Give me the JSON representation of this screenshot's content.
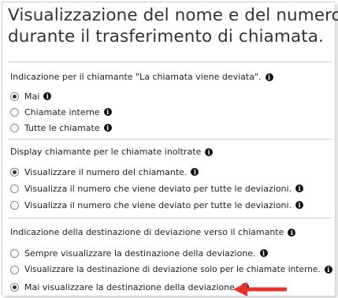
{
  "title_lines": [
    "Visualizzazione del nome e del numero",
    "durante il trasferimento di chiamata."
  ],
  "sections": [
    {
      "label": "Indicazione per il chiamante \"La chiamata viene deviata\".",
      "options": [
        {
          "label": "Mai",
          "checked": true
        },
        {
          "label": "Chiamate interne",
          "checked": false
        },
        {
          "label": "Tutte le chiamate",
          "checked": false
        }
      ]
    },
    {
      "label": "Display chiamante per le chiamate inoltrate",
      "options": [
        {
          "label": "Visualizzare il numero del chiamante.",
          "checked": true
        },
        {
          "label": "Visualizza il numero che viene deviato per tutte le deviazioni.",
          "checked": false
        },
        {
          "label": "Visualizza il numero che viene deviato per tutte le deviazioni.",
          "checked": false
        }
      ]
    },
    {
      "label": "Indicazione della destinazione di deviazione verso il chiamante",
      "options": [
        {
          "label": "Sempre visualizzare la destinazione della deviazione.",
          "checked": false
        },
        {
          "label": "Visualizzare la destinazione di deviazione solo per le chiamate interne.",
          "checked": false
        },
        {
          "label": "Mai visualizzare la destinazione della deviazione.",
          "checked": true
        }
      ]
    }
  ],
  "info_icon_glyph": "i",
  "annotation_arrow_color": "#e8332a"
}
